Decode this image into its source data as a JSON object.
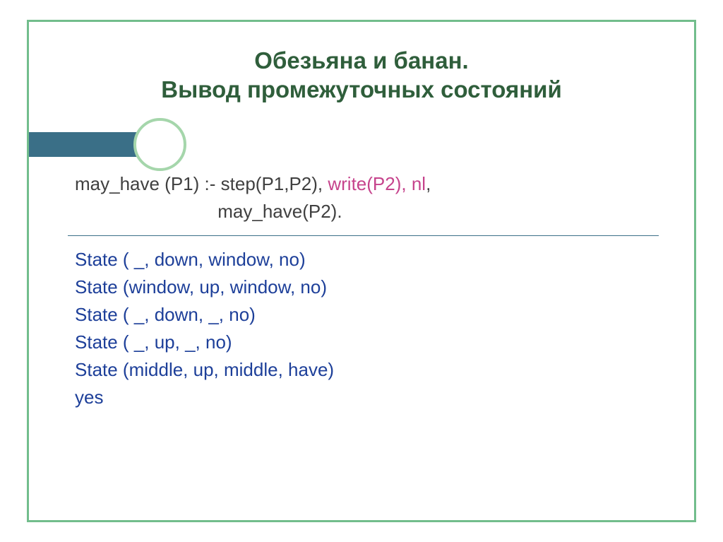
{
  "title": {
    "line1": "Обезьяна и банан.",
    "line2": "Вывод промежуточных состояний"
  },
  "rule": {
    "head": "may_have (P1) :- ",
    "step": "step(P1,P2), ",
    "write": "write(P2), nl",
    "comma": ",",
    "indent": "                            ",
    "tail": "may_have(P2)."
  },
  "states": [
    "State ( _, down, window, no)",
    "State (window, up, window, no)",
    "State ( _, down, _, no)",
    "State ( _, up, _, no)",
    "State (middle, up, middle, have)",
    "yes"
  ]
}
